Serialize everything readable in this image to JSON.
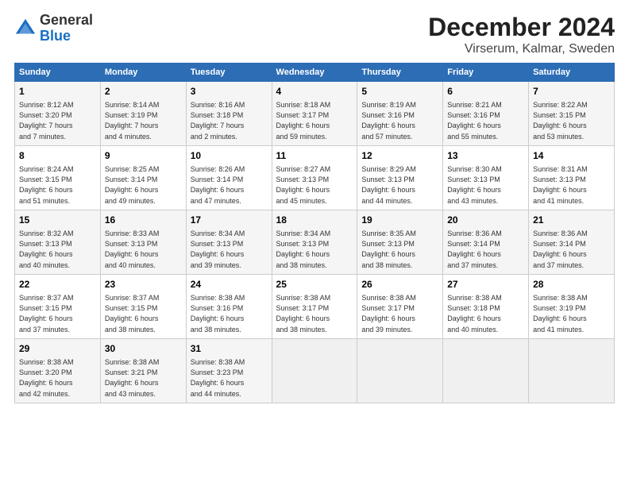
{
  "logo": {
    "general": "General",
    "blue": "Blue"
  },
  "title": "December 2024",
  "subtitle": "Virserum, Kalmar, Sweden",
  "headers": [
    "Sunday",
    "Monday",
    "Tuesday",
    "Wednesday",
    "Thursday",
    "Friday",
    "Saturday"
  ],
  "weeks": [
    [
      {
        "day": "1",
        "info": "Sunrise: 8:12 AM\nSunset: 3:20 PM\nDaylight: 7 hours\nand 7 minutes."
      },
      {
        "day": "2",
        "info": "Sunrise: 8:14 AM\nSunset: 3:19 PM\nDaylight: 7 hours\nand 4 minutes."
      },
      {
        "day": "3",
        "info": "Sunrise: 8:16 AM\nSunset: 3:18 PM\nDaylight: 7 hours\nand 2 minutes."
      },
      {
        "day": "4",
        "info": "Sunrise: 8:18 AM\nSunset: 3:17 PM\nDaylight: 6 hours\nand 59 minutes."
      },
      {
        "day": "5",
        "info": "Sunrise: 8:19 AM\nSunset: 3:16 PM\nDaylight: 6 hours\nand 57 minutes."
      },
      {
        "day": "6",
        "info": "Sunrise: 8:21 AM\nSunset: 3:16 PM\nDaylight: 6 hours\nand 55 minutes."
      },
      {
        "day": "7",
        "info": "Sunrise: 8:22 AM\nSunset: 3:15 PM\nDaylight: 6 hours\nand 53 minutes."
      }
    ],
    [
      {
        "day": "8",
        "info": "Sunrise: 8:24 AM\nSunset: 3:15 PM\nDaylight: 6 hours\nand 51 minutes."
      },
      {
        "day": "9",
        "info": "Sunrise: 8:25 AM\nSunset: 3:14 PM\nDaylight: 6 hours\nand 49 minutes."
      },
      {
        "day": "10",
        "info": "Sunrise: 8:26 AM\nSunset: 3:14 PM\nDaylight: 6 hours\nand 47 minutes."
      },
      {
        "day": "11",
        "info": "Sunrise: 8:27 AM\nSunset: 3:13 PM\nDaylight: 6 hours\nand 45 minutes."
      },
      {
        "day": "12",
        "info": "Sunrise: 8:29 AM\nSunset: 3:13 PM\nDaylight: 6 hours\nand 44 minutes."
      },
      {
        "day": "13",
        "info": "Sunrise: 8:30 AM\nSunset: 3:13 PM\nDaylight: 6 hours\nand 43 minutes."
      },
      {
        "day": "14",
        "info": "Sunrise: 8:31 AM\nSunset: 3:13 PM\nDaylight: 6 hours\nand 41 minutes."
      }
    ],
    [
      {
        "day": "15",
        "info": "Sunrise: 8:32 AM\nSunset: 3:13 PM\nDaylight: 6 hours\nand 40 minutes."
      },
      {
        "day": "16",
        "info": "Sunrise: 8:33 AM\nSunset: 3:13 PM\nDaylight: 6 hours\nand 40 minutes."
      },
      {
        "day": "17",
        "info": "Sunrise: 8:34 AM\nSunset: 3:13 PM\nDaylight: 6 hours\nand 39 minutes."
      },
      {
        "day": "18",
        "info": "Sunrise: 8:34 AM\nSunset: 3:13 PM\nDaylight: 6 hours\nand 38 minutes."
      },
      {
        "day": "19",
        "info": "Sunrise: 8:35 AM\nSunset: 3:13 PM\nDaylight: 6 hours\nand 38 minutes."
      },
      {
        "day": "20",
        "info": "Sunrise: 8:36 AM\nSunset: 3:14 PM\nDaylight: 6 hours\nand 37 minutes."
      },
      {
        "day": "21",
        "info": "Sunrise: 8:36 AM\nSunset: 3:14 PM\nDaylight: 6 hours\nand 37 minutes."
      }
    ],
    [
      {
        "day": "22",
        "info": "Sunrise: 8:37 AM\nSunset: 3:15 PM\nDaylight: 6 hours\nand 37 minutes."
      },
      {
        "day": "23",
        "info": "Sunrise: 8:37 AM\nSunset: 3:15 PM\nDaylight: 6 hours\nand 38 minutes."
      },
      {
        "day": "24",
        "info": "Sunrise: 8:38 AM\nSunset: 3:16 PM\nDaylight: 6 hours\nand 38 minutes."
      },
      {
        "day": "25",
        "info": "Sunrise: 8:38 AM\nSunset: 3:17 PM\nDaylight: 6 hours\nand 38 minutes."
      },
      {
        "day": "26",
        "info": "Sunrise: 8:38 AM\nSunset: 3:17 PM\nDaylight: 6 hours\nand 39 minutes."
      },
      {
        "day": "27",
        "info": "Sunrise: 8:38 AM\nSunset: 3:18 PM\nDaylight: 6 hours\nand 40 minutes."
      },
      {
        "day": "28",
        "info": "Sunrise: 8:38 AM\nSunset: 3:19 PM\nDaylight: 6 hours\nand 41 minutes."
      }
    ],
    [
      {
        "day": "29",
        "info": "Sunrise: 8:38 AM\nSunset: 3:20 PM\nDaylight: 6 hours\nand 42 minutes."
      },
      {
        "day": "30",
        "info": "Sunrise: 8:38 AM\nSunset: 3:21 PM\nDaylight: 6 hours\nand 43 minutes."
      },
      {
        "day": "31",
        "info": "Sunrise: 8:38 AM\nSunset: 3:23 PM\nDaylight: 6 hours\nand 44 minutes."
      },
      {
        "day": "",
        "info": ""
      },
      {
        "day": "",
        "info": ""
      },
      {
        "day": "",
        "info": ""
      },
      {
        "day": "",
        "info": ""
      }
    ]
  ]
}
